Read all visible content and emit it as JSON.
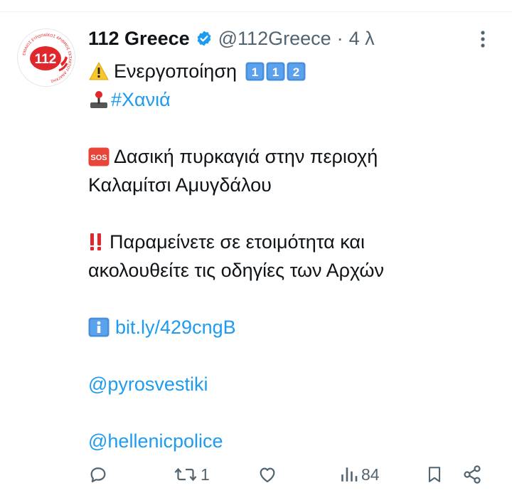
{
  "tweet": {
    "author": {
      "display_name": "112 Greece",
      "handle": "@112Greece",
      "separator": "·",
      "timestamp": "4 λ",
      "avatar_text": "112",
      "avatar_ring_text": "ΕΝΙΑΙΟΣ ΕΥΡΩΠΑΪΚΟΣ ΑΡΙΘΜΟΣ ΕΚΤΑΚΤΟΥ ΑΝΑΓΚΗΣ"
    },
    "lines": {
      "activation": "Ενεργοποίηση",
      "activation_badges": [
        "1",
        "1",
        "2"
      ],
      "hashtag": "#Χανιά",
      "alert_line1": "Δασική πυρκαγιά στην περιοχή",
      "alert_line2": "Καλαμίτσι Αμυγδάλου",
      "instruction_line1": "Παραμείνετε σε ετοιμότητα και",
      "instruction_line2": "ακολουθείτε τις οδηγίες των Αρχών",
      "info_link": "bit.ly/429cngB",
      "mention1": "@pyrosvestiki",
      "mention2": "@hellenicpolice"
    },
    "icons": {
      "warning": "warning-icon",
      "joystick": "joystick-icon",
      "sos": "sos-icon",
      "double_exclamation": "double-exclamation-icon",
      "info": "info-icon"
    },
    "actions": {
      "reply_count": "",
      "retweet_count": "1",
      "like_count": "",
      "views_count": "84"
    }
  },
  "colors": {
    "text": "#0f1419",
    "secondary": "#536471",
    "link": "#1d9bf0",
    "verified": "#1d9bf0",
    "avatar_red": "#e0282c"
  }
}
